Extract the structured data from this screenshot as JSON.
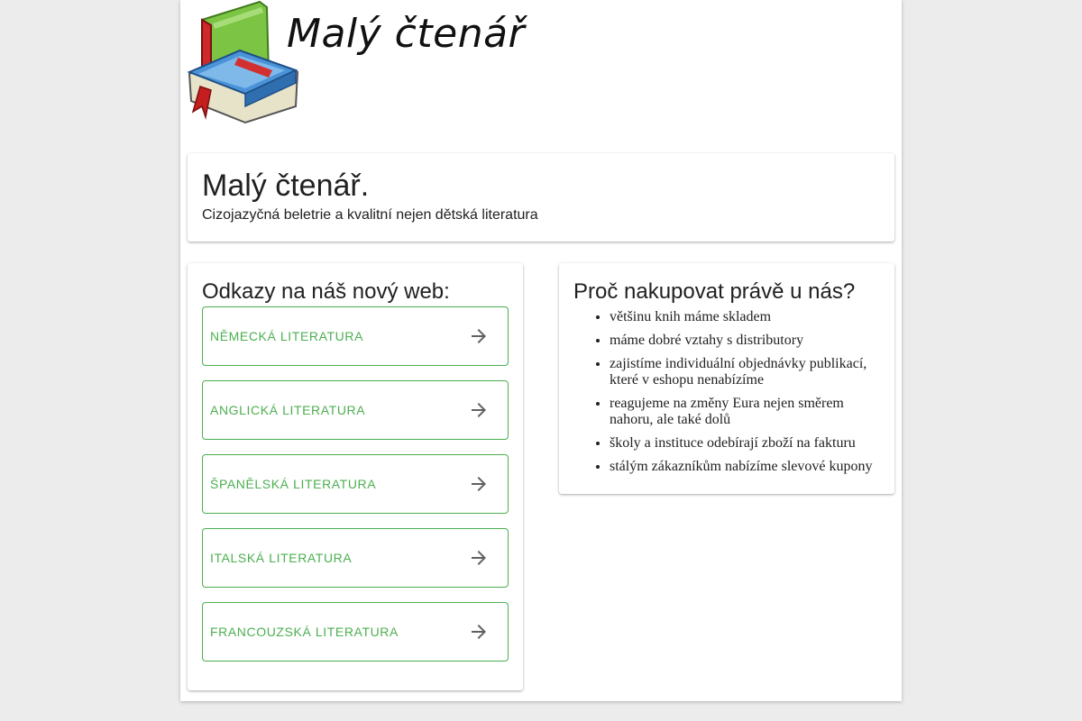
{
  "logo": {
    "text": "Malý čtenář",
    "icon": "book-icon"
  },
  "header": {
    "title": "Malý čtenář.",
    "subtitle": "Cizojazyčná beletrie a kvalitní nejen dětská literatura"
  },
  "links": {
    "heading": "Odkazy na náš nový web:",
    "items": [
      {
        "label": "Německá literatura",
        "icon": "arrow-right-icon"
      },
      {
        "label": "Anglická literatura",
        "icon": "arrow-right-icon"
      },
      {
        "label": "Španělská literatura",
        "icon": "arrow-right-icon"
      },
      {
        "label": "Italská literatura",
        "icon": "arrow-right-icon"
      },
      {
        "label": "Francouzská literatura",
        "icon": "arrow-right-icon"
      }
    ]
  },
  "why": {
    "heading": "Proč nakupovat právě u nás?",
    "items": [
      "většinu knih máme skladem",
      "máme dobré vztahy s distributory",
      "zajistíme individuální objednávky publikací, které v eshopu nenabízíme",
      "reagujeme na změny Eura nejen směrem nahoru, ale také dolů",
      "školy a instituce odebírají zboží na fakturu",
      "stálým zákazníkům nabízíme slevové kupony"
    ]
  },
  "colors": {
    "accent": "#4caf50",
    "background": "#ececec",
    "card": "#ffffff"
  }
}
